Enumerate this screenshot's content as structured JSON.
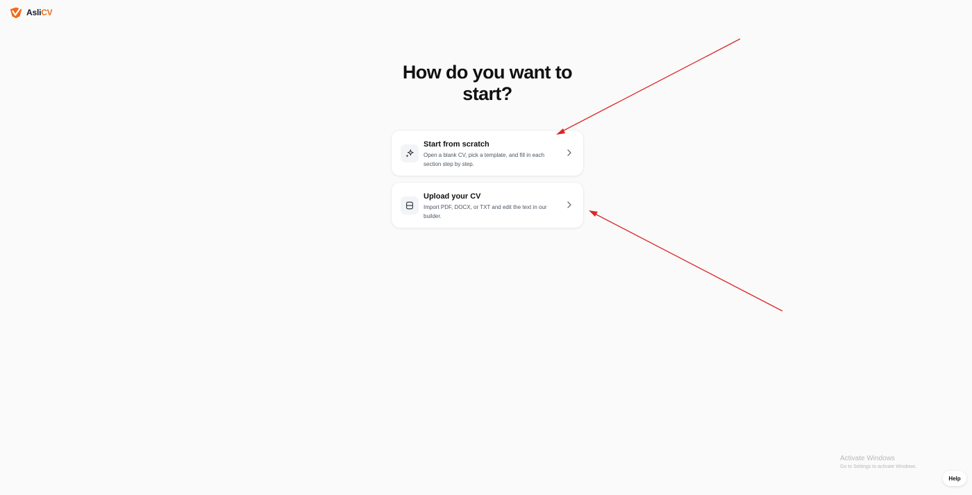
{
  "brand": {
    "name_part1": "Asli",
    "name_part2": "CV",
    "accent_color": "#ef6c1a",
    "icon": "aslicv-logo"
  },
  "heading": "How do you want to start?",
  "options": [
    {
      "title": "Start from scratch",
      "description": "Open a blank CV, pick a template, and fill in each section step by step.",
      "icon": "sparkles-icon"
    },
    {
      "title": "Upload your CV",
      "description": "Import PDF, DOCX, or TXT and edit the text in our builder.",
      "icon": "upload-document-icon"
    }
  ],
  "annotations": {
    "arrow_color": "#dc2626",
    "arrow_count": 2
  },
  "os_watermark": {
    "title": "Activate Windows",
    "subtitle": "Go to Settings to activate Windows."
  },
  "help_label": "Help"
}
